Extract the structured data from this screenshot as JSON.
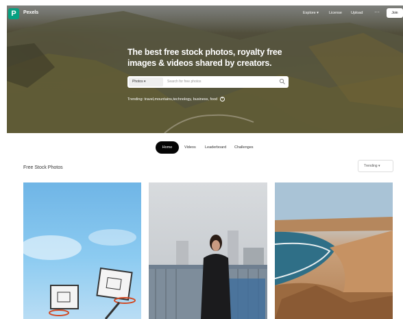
{
  "brand": {
    "name": "Pexels",
    "logo_letter": "P"
  },
  "nav": {
    "explore_label": "Explore ▾",
    "license_label": "License",
    "upload_label": "Upload",
    "more_label": "···",
    "join_label": "Join"
  },
  "hero": {
    "headline": "The best free stock photos, royalty free images & videos shared by creators.",
    "search": {
      "filter_label": "Photos ▾",
      "placeholder": "Search for free photos"
    },
    "trending_label": "Trending:",
    "trending_items": [
      "travel,",
      "mountains,",
      "technology,",
      "business,",
      "food"
    ]
  },
  "tabs": [
    {
      "label": "Home",
      "active": true
    },
    {
      "label": "Videos",
      "active": false
    },
    {
      "label": "Leaderboard",
      "active": false
    },
    {
      "label": "Challenges",
      "active": false
    }
  ],
  "section": {
    "title": "Free Stock Photos",
    "sort_label": "Trending ▾"
  },
  "photos": [
    {
      "subject": "basketball hoops against blue sky"
    },
    {
      "subject": "woman in black coat on city bridge"
    },
    {
      "subject": "coastal desert beach"
    }
  ],
  "colors": {
    "brand_green": "#05a081",
    "tab_active_bg": "#050505"
  }
}
